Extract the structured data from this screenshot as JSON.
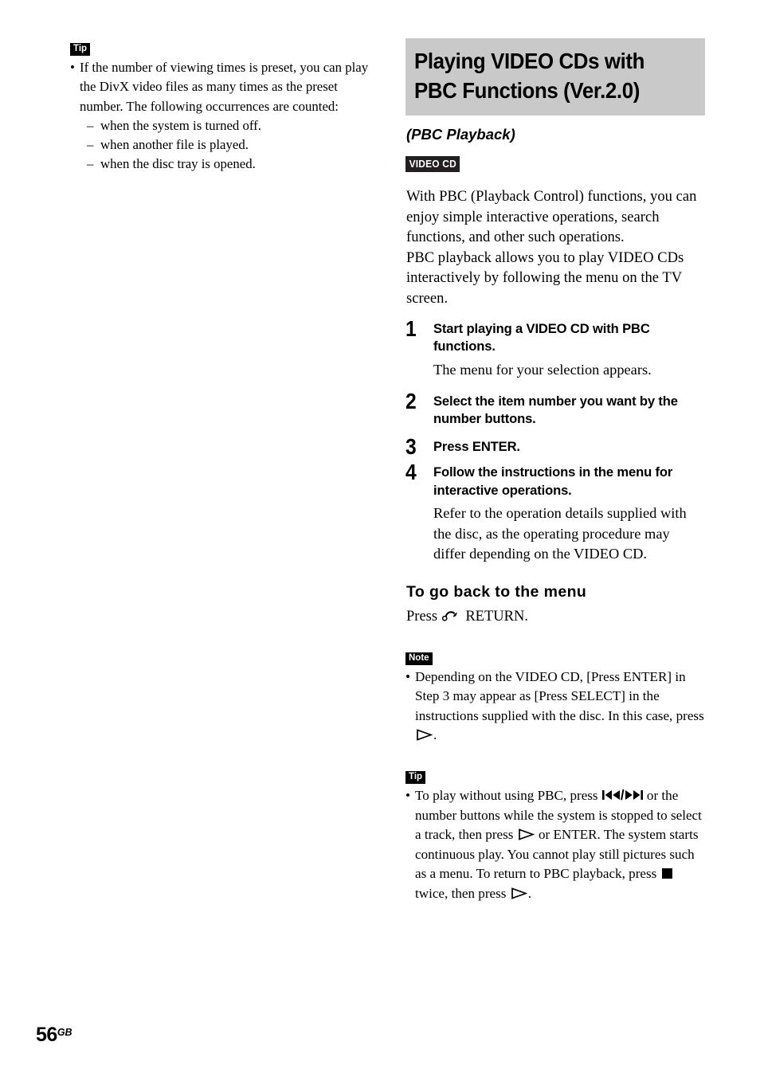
{
  "page": {
    "folio_number": "56",
    "folio_suffix": "GB",
    "background_color": "#ffffff",
    "heading_band_color": "#c9c9c9",
    "badge_color": "#000000"
  },
  "left_column": {
    "tip": {
      "badge_label": "Tip",
      "bullet_symbol": "•",
      "text": "If the number of viewing times is preset, you can play the DivX video files as many times as the preset number. The following occurrences are counted:",
      "sub_items": [
        {
          "dash": "–",
          "text": "when the system is turned off."
        },
        {
          "dash": "–",
          "text": "when another file is played."
        },
        {
          "dash": "–",
          "text": "when the disc tray is opened."
        }
      ]
    }
  },
  "right_column": {
    "heading": "Playing VIDEO CDs with\nPBC Functions (Ver.2.0)",
    "subtitle": "(PBC Playback)",
    "disc_badge": "VIDEO CD",
    "intro": "With PBC (Playback Control) functions, you can enjoy simple interactive operations, search functions, and other such operations.\nPBC playback allows you to play VIDEO CDs interactively by following the menu on the TV screen.",
    "steps": [
      {
        "number": "1",
        "title": "Start playing a VIDEO CD with PBC functions.",
        "body": "The menu for your selection appears."
      },
      {
        "number": "2",
        "title": "Select the item number you want by the number buttons.",
        "body": ""
      },
      {
        "number": "3",
        "title": "Press ENTER.",
        "body": ""
      },
      {
        "number": "4",
        "title": "Follow the instructions in the menu for interactive operations.",
        "body": "Refer to the operation details supplied with the disc, as the operating procedure may differ depending on the VIDEO CD."
      }
    ],
    "sub_heading": "To go back to the menu",
    "press_return": {
      "prefix": "Press",
      "icon": "return-icon",
      "suffix": "RETURN."
    },
    "note": {
      "badge_label": "Note",
      "bullet_symbol": "•",
      "text_part_1": "Depending on the VIDEO CD, [Press ENTER] in Step 3 may appear as [Press SELECT] in the instructions supplied with the disc. In this case, press",
      "text_part_2": "."
    },
    "tip": {
      "badge_label": "Tip",
      "bullet_symbol": "•",
      "text_part_1": "To play without using PBC, press",
      "slash": "/",
      "text_part_2": "or the number buttons while the system is stopped to select a track, then press",
      "text_part_3": "or ENTER. The system starts continuous play. You cannot play still pictures such as a menu. To return to PBC playback, press",
      "text_part_4": "twice, then press",
      "text_part_5": "."
    }
  }
}
